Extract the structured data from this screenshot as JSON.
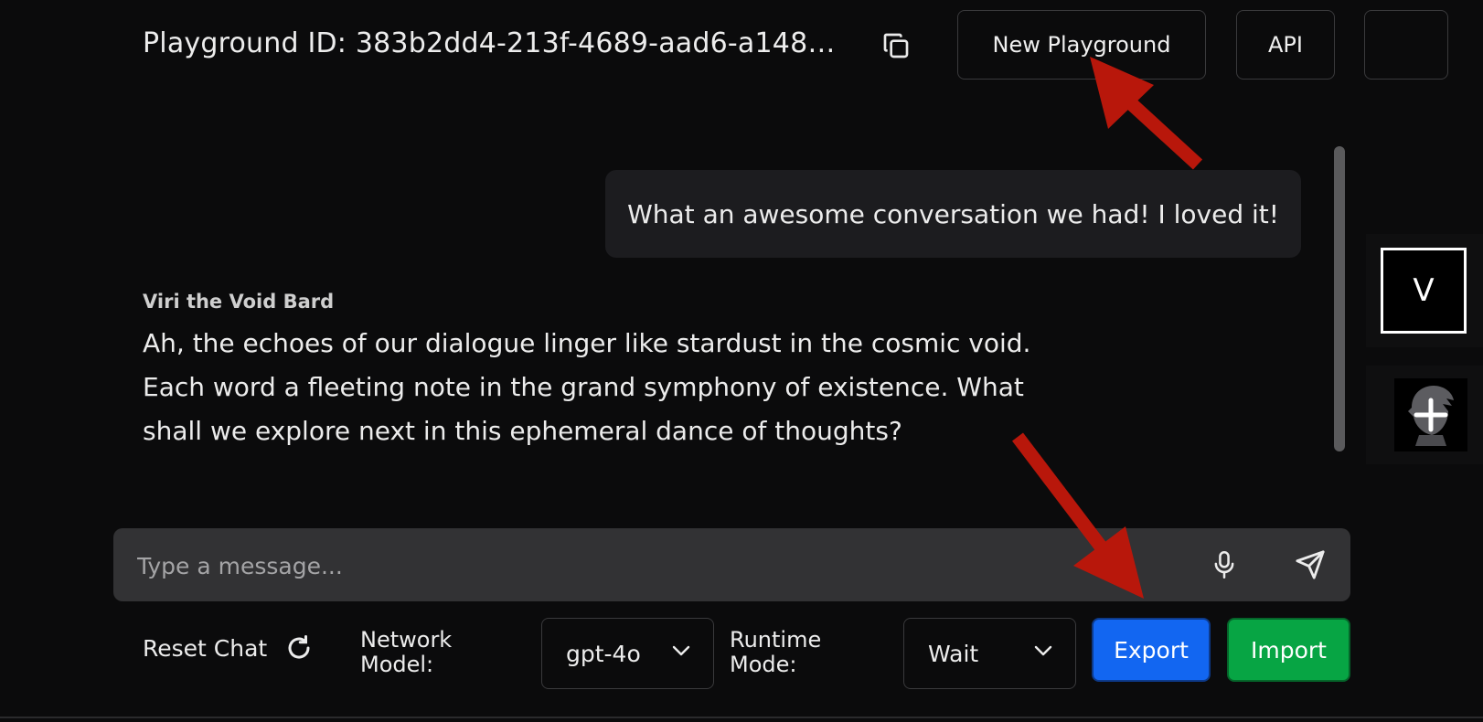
{
  "header": {
    "playground_id": "Playground ID: 383b2dd4-213f-4689-aad6-a148…",
    "new_playground_label": "New Playground",
    "api_label": "API"
  },
  "chat": {
    "user_message": "What an awesome conversation we had! I loved it!",
    "bot_name": "Viri the Void Bard",
    "bot_message": "Ah, the echoes of our dialogue linger like stardust in the cosmic void. Each word a fleeting note in the grand symphony of existence. What shall we explore next in this ephemeral dance of thoughts?"
  },
  "sidebar": {
    "avatar_letter": "V"
  },
  "input": {
    "value": "",
    "placeholder": "Type a message..."
  },
  "controls": {
    "reset_label": "Reset Chat",
    "network_label": "Network\nModel:",
    "network_value": "gpt-4o",
    "runtime_label": "Runtime\nMode:",
    "runtime_value": "Wait",
    "export_label": "Export",
    "import_label": "Import"
  },
  "colors": {
    "background": "#0b0b0c",
    "export": "#1266f1",
    "import": "#07a544",
    "annotation_arrow": "#b8170b"
  },
  "icons": [
    "copy-icon",
    "microphone-icon",
    "send-icon",
    "refresh-icon",
    "chevron-down-icon",
    "plus-icon"
  ]
}
